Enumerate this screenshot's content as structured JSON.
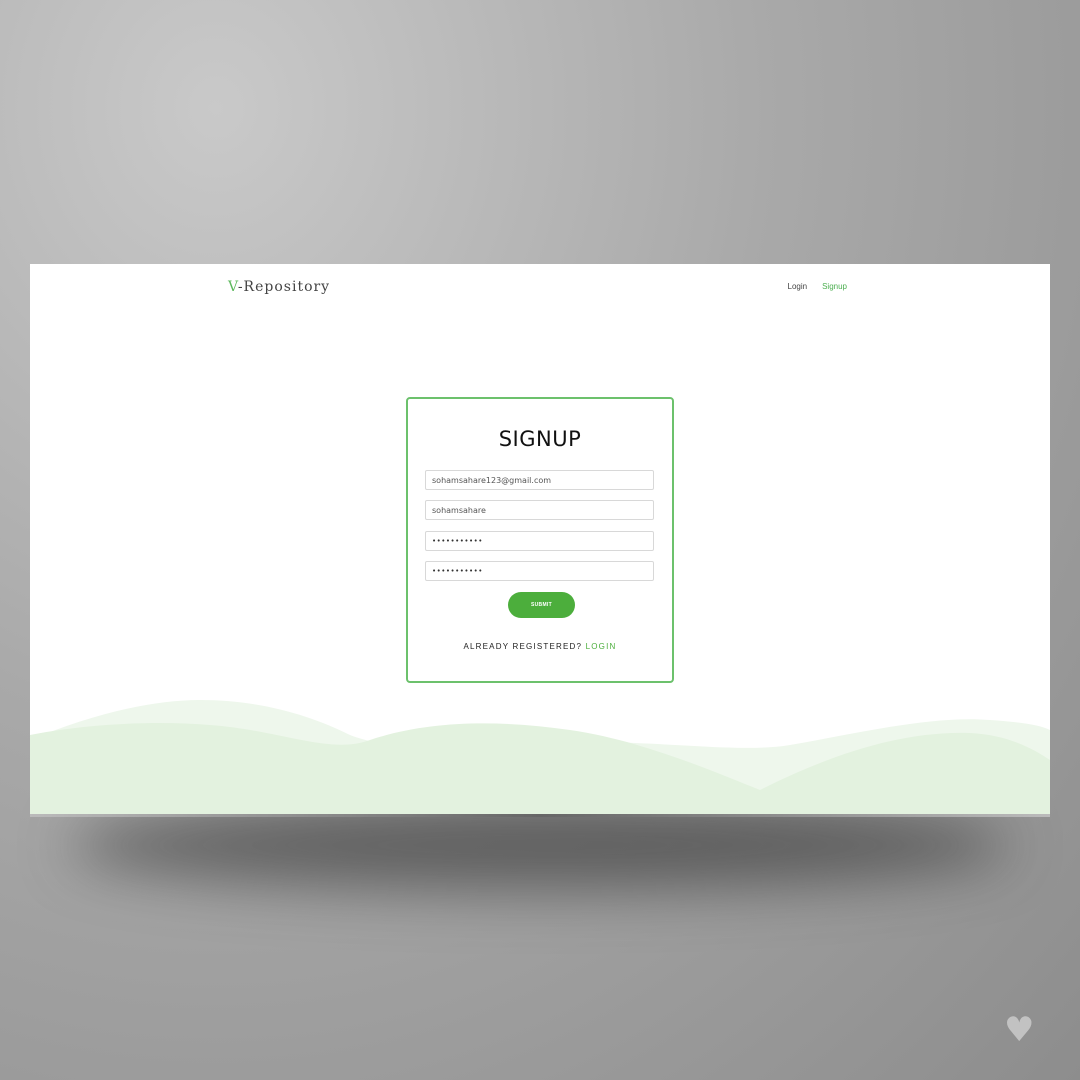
{
  "header": {
    "brand_accent": "V",
    "brand_rest": "-Repository",
    "nav": {
      "login": "Login",
      "signup": "Signup"
    }
  },
  "form": {
    "title": "SIGNUP",
    "email_value": "sohamsahare123@gmail.com",
    "username_value": "sohamsahare",
    "password_mask": "•••••••••••",
    "confirm_password_mask": "•••••••••••",
    "submit_label": "SUBMIT",
    "already_registered_text": "ALREADY REGISTERED?",
    "login_link": "LOGIN"
  },
  "colors": {
    "accent": "#4cae3c",
    "card_border": "#6cc16c",
    "wave_light": "#eef7ec",
    "wave_dark": "#e3f2df"
  },
  "icons": {
    "corner_watermark": "heart-icon"
  }
}
